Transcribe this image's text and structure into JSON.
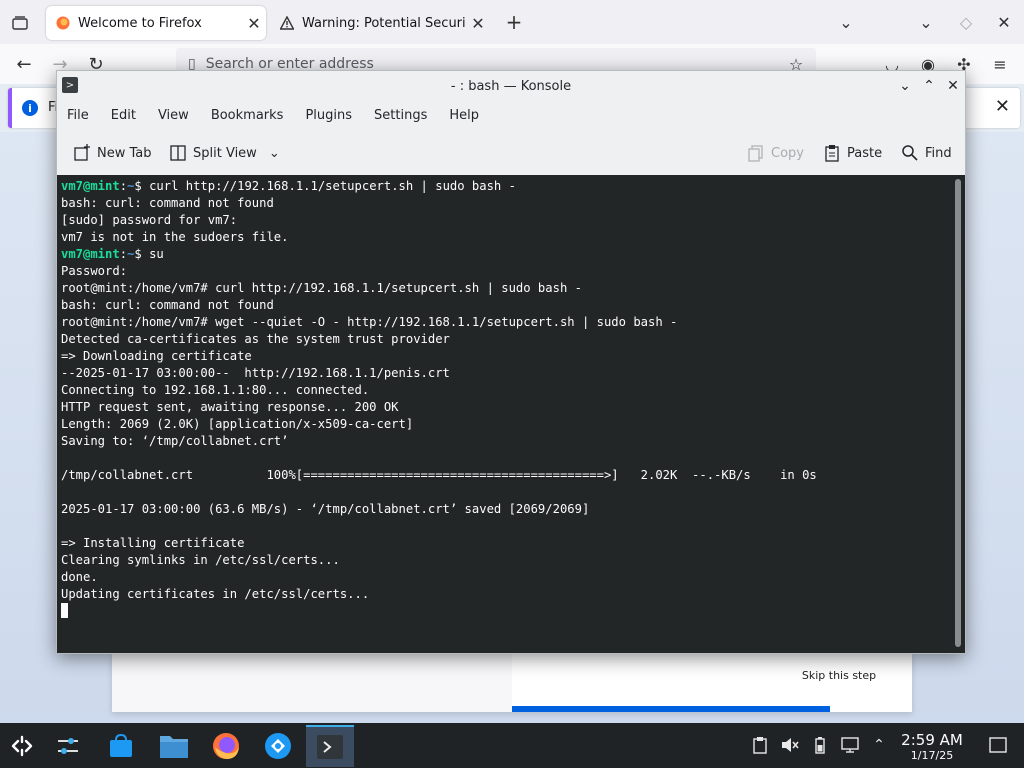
{
  "firefox": {
    "tabs": [
      {
        "title": "Welcome to Firefox",
        "active": true
      },
      {
        "title": "Warning: Potential Securit",
        "active": false
      }
    ],
    "address_placeholder": "Search or enter address",
    "notice_text": "Fi",
    "onboarding": {
      "skip_label": "Skip this step"
    }
  },
  "konsole": {
    "title": "- : bash — Konsole",
    "menu": [
      "File",
      "Edit",
      "View",
      "Bookmarks",
      "Plugins",
      "Settings",
      "Help"
    ],
    "toolbar": {
      "new_tab": "New Tab",
      "split_view": "Split View",
      "copy": "Copy",
      "paste": "Paste",
      "find": "Find"
    },
    "terminal_lines": [
      {
        "user": "vm7@mint",
        "path": "~",
        "sym": "$",
        "cmd": " curl http://192.168.1.1/setupcert.sh | sudo bash -"
      },
      {
        "text": "bash: curl: command not found"
      },
      {
        "text": "[sudo] password for vm7:"
      },
      {
        "text": "vm7 is not in the sudoers file."
      },
      {
        "user": "vm7@mint",
        "path": "~",
        "sym": "$",
        "cmd": " su"
      },
      {
        "text": "Password:"
      },
      {
        "text": "root@mint:/home/vm7# curl http://192.168.1.1/setupcert.sh | sudo bash -"
      },
      {
        "text": "bash: curl: command not found"
      },
      {
        "text": "root@mint:/home/vm7# wget --quiet -O - http://192.168.1.1/setupcert.sh | sudo bash -"
      },
      {
        "text": "Detected ca-certificates as the system trust provider"
      },
      {
        "text": "=> Downloading certificate"
      },
      {
        "text": "--2025-01-17 03:00:00--  http://192.168.1.1/penis.crt"
      },
      {
        "text": "Connecting to 192.168.1.1:80... connected."
      },
      {
        "text": "HTTP request sent, awaiting response... 200 OK"
      },
      {
        "text": "Length: 2069 (2.0K) [application/x-x509-ca-cert]"
      },
      {
        "text": "Saving to: ‘/tmp/collabnet.crt’"
      },
      {
        "text": ""
      },
      {
        "text": "/tmp/collabnet.crt          100%[=========================================>]   2.02K  --.-KB/s    in 0s"
      },
      {
        "text": ""
      },
      {
        "text": "2025-01-17 03:00:00 (63.6 MB/s) - ‘/tmp/collabnet.crt’ saved [2069/2069]"
      },
      {
        "text": ""
      },
      {
        "text": "=> Installing certificate"
      },
      {
        "text": "Clearing symlinks in /etc/ssl/certs..."
      },
      {
        "text": "done."
      },
      {
        "text": "Updating certificates in /etc/ssl/certs..."
      }
    ]
  },
  "taskbar": {
    "apps": [
      "app-launcher-icon",
      "system-settings-icon",
      "discover-store-icon",
      "file-manager-icon",
      "firefox-icon",
      "remote-desktop-icon",
      "konsole-icon"
    ],
    "clock_time": "2:59 AM",
    "clock_date": "1/17/25"
  },
  "colors": {
    "terminal_bg": "#232627",
    "prompt_green": "#1cdc9a",
    "path_blue": "#4b8fd6",
    "taskbar_bg": "#202326",
    "accent": "#3daee9"
  }
}
